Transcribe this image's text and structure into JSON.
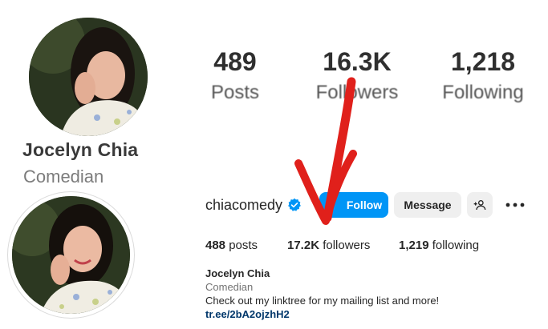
{
  "top_profile": {
    "name": "Jocelyn Chia",
    "category": "Comedian",
    "stats": [
      {
        "value": "489",
        "label": "Posts"
      },
      {
        "value": "16.3K",
        "label": "Followers"
      },
      {
        "value": "1,218",
        "label": "Following"
      }
    ]
  },
  "bottom_profile": {
    "username": "chiacomedy",
    "follow_label": "Follow",
    "message_label": "Message",
    "counts": {
      "posts_num": "488",
      "posts_label": " posts",
      "followers_num": "17.2K",
      "followers_label": " followers",
      "following_num": "1,219",
      "following_label": " following"
    },
    "bio": {
      "name": "Jocelyn Chia",
      "category": "Comedian",
      "text": "Check out my linktree for my mailing list and more!",
      "link": "tr.ee/2bA2ojzhH2"
    }
  },
  "colors": {
    "follow_blue": "#0095f6",
    "verified_blue": "#0095f6",
    "annotation_red": "#e0201b",
    "link_blue": "#00376b"
  },
  "icons": [
    "verified-badge-icon",
    "add-user-icon",
    "more-options-icon",
    "red-arrow-annotation"
  ]
}
